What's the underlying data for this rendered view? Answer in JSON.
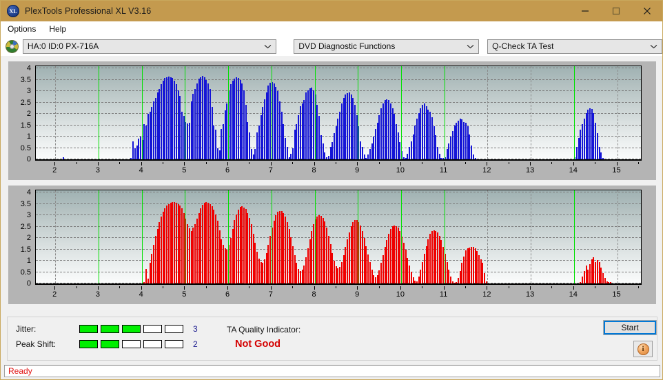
{
  "window": {
    "title": "PlexTools Professional XL V3.16",
    "app_icon": "xl-logo-icon",
    "minimize": "minimize-icon",
    "maximize": "maximize-icon",
    "close": "close-icon"
  },
  "menu": {
    "items": [
      {
        "label": "Options"
      },
      {
        "label": "Help"
      }
    ]
  },
  "toolbar": {
    "drive_icon": "optical-disc-icon",
    "drive": "HA:0 ID:0  PX-716A",
    "function": "DVD Diagnostic Functions",
    "test": "Q-Check TA Test"
  },
  "status_panel": {
    "jitter_label": "Jitter:",
    "jitter_value": "3",
    "jitter_filled": 3,
    "jitter_total": 5,
    "peak_shift_label": "Peak Shift:",
    "peak_shift_value": "2",
    "peak_shift_filled": 2,
    "peak_shift_total": 5,
    "ta_label": "TA Quality Indicator:",
    "ta_value": "Not Good",
    "ta_color": "#d40000",
    "meter_on_color": "#00ef00",
    "start_label": "Start",
    "info_label": "i"
  },
  "statusbar": {
    "text": "Ready",
    "color": "#e01010"
  },
  "chart_data": [
    {
      "type": "bar",
      "title": "Jitter (top chart)",
      "xlabel": "",
      "ylabel": "",
      "series_color": "#1515d6",
      "marker_color": "#00e000",
      "grid": true,
      "xlim": [
        1.55,
        15.55
      ],
      "ylim": [
        0,
        4.1
      ],
      "xticks": [
        2,
        3,
        4,
        5,
        6,
        7,
        8,
        9,
        10,
        11,
        12,
        13,
        14,
        15
      ],
      "yticks": [
        0,
        0.5,
        1,
        1.5,
        2,
        2.5,
        3,
        3.5,
        4
      ],
      "markers_x": [
        3,
        4,
        5,
        6,
        7,
        8,
        9,
        10,
        11,
        14
      ],
      "bar_step": 0.0435,
      "x_start": 2.0,
      "values": [
        0.0,
        0.0,
        0.0,
        0.0,
        0.08,
        0.0,
        0.0,
        0.0,
        0.0,
        0.0,
        0.0,
        0.0,
        0.0,
        0.0,
        0.0,
        0.0,
        0.0,
        0.0,
        0.0,
        0.0,
        0.0,
        0.0,
        0.0,
        0.0,
        0.0,
        0.0,
        0.0,
        0.0,
        0.0,
        0.0,
        0.0,
        0.0,
        0.0,
        0.0,
        0.0,
        0.0,
        0.0,
        0.0,
        0.0,
        0.0,
        0.05,
        0.8,
        0.5,
        0.6,
        0.92,
        1.0,
        0.85,
        1.55,
        1.5,
        2.0,
        2.1,
        2.3,
        2.55,
        2.7,
        2.95,
        3.1,
        3.3,
        3.45,
        3.58,
        3.62,
        3.65,
        3.6,
        3.58,
        3.45,
        3.3,
        3.05,
        2.8,
        2.1,
        1.9,
        1.65,
        1.58,
        1.6,
        2.55,
        2.9,
        3.1,
        3.35,
        3.55,
        3.62,
        3.68,
        3.6,
        3.5,
        3.35,
        3.1,
        2.3,
        1.5,
        1.3,
        0.5,
        0.4,
        1.35,
        1.55,
        2.15,
        2.45,
        3.0,
        3.3,
        3.45,
        3.55,
        3.6,
        3.58,
        3.5,
        3.35,
        3.05,
        2.4,
        1.65,
        1.2,
        0.45,
        0.2,
        0.45,
        1.2,
        1.5,
        1.95,
        2.3,
        2.65,
        2.95,
        3.25,
        3.38,
        3.4,
        3.35,
        3.2,
        3.0,
        2.55,
        2.1,
        1.55,
        0.95,
        0.55,
        0.1,
        0.25,
        0.5,
        1.3,
        1.55,
        1.95,
        2.35,
        2.45,
        2.6,
        2.95,
        3.05,
        3.12,
        3.15,
        3.05,
        2.85,
        2.4,
        1.9,
        1.05,
        0.7,
        0.3,
        0.08,
        0.15,
        0.55,
        0.75,
        1.15,
        1.45,
        1.8,
        2.1,
        2.45,
        2.7,
        2.85,
        2.93,
        2.95,
        2.85,
        2.7,
        2.4,
        1.95,
        1.45,
        0.8,
        0.55,
        0.2,
        0.05,
        0.2,
        0.45,
        0.7,
        1.0,
        1.35,
        1.6,
        1.95,
        2.25,
        2.45,
        2.6,
        2.65,
        2.6,
        2.45,
        2.25,
        2.0,
        1.55,
        1.2,
        0.75,
        0.35,
        0.1,
        0.05,
        0.25,
        0.55,
        0.8,
        1.1,
        1.5,
        1.8,
        2.05,
        2.25,
        2.4,
        2.45,
        2.35,
        2.2,
        2.1,
        1.85,
        1.45,
        1.05,
        0.55,
        0.25,
        0.05,
        0.05,
        0.1,
        0.45,
        0.7,
        1.0,
        1.25,
        1.5,
        1.62,
        1.7,
        1.78,
        1.75,
        1.65,
        1.62,
        1.45,
        1.1,
        0.6,
        0.2,
        0.05,
        0.0,
        0.0,
        0.0,
        0.0,
        0.0,
        0.0,
        0.0,
        0.0,
        0.0,
        0.0,
        0.0,
        0.0,
        0.0,
        0.0,
        0.0,
        0.0,
        0.0,
        0.0,
        0.0,
        0.0,
        0.0,
        0.0,
        0.0,
        0.0,
        0.0,
        0.0,
        0.0,
        0.0,
        0.0,
        0.0,
        0.0,
        0.0,
        0.0,
        0.0,
        0.0,
        0.0,
        0.0,
        0.0,
        0.0,
        0.0,
        0.0,
        0.0,
        0.0,
        0.0,
        0.0,
        0.0,
        0.0,
        0.0,
        0.0,
        0.0,
        0.0,
        0.0,
        0.1,
        0.55,
        0.95,
        1.3,
        1.55,
        1.8,
        2.05,
        2.2,
        2.25,
        2.22,
        2.05,
        1.6,
        1.15,
        0.55,
        0.3,
        0.05,
        0.0,
        0.0,
        0.0,
        0.0,
        0.0,
        0.0,
        0.0,
        0.0,
        0.0,
        0.0,
        0.0,
        0.0,
        0.0,
        0.0,
        0.0,
        0.0,
        0.0,
        0.0,
        0.0,
        0.0,
        0.0,
        0.0,
        0.0,
        0.0,
        0.0,
        0.0,
        0.0,
        0.0
      ]
    },
    {
      "type": "bar",
      "title": "Peak Shift (bottom chart)",
      "xlabel": "",
      "ylabel": "",
      "series_color": "#ef0000",
      "marker_color": "#00e000",
      "grid": true,
      "xlim": [
        1.55,
        15.55
      ],
      "ylim": [
        0,
        4.1
      ],
      "xticks": [
        2,
        3,
        4,
        5,
        6,
        7,
        8,
        9,
        10,
        11,
        12,
        13,
        14,
        15
      ],
      "yticks": [
        0,
        0.5,
        1,
        1.5,
        2,
        2.5,
        3,
        3.5,
        4
      ],
      "markers_x": [
        3,
        4,
        5,
        6,
        7,
        8,
        9,
        10,
        11,
        14
      ],
      "bar_step": 0.0435,
      "x_start": 2.0,
      "values": [
        0.0,
        0.0,
        0.0,
        0.0,
        0.0,
        0.0,
        0.0,
        0.0,
        0.0,
        0.0,
        0.0,
        0.0,
        0.0,
        0.0,
        0.0,
        0.0,
        0.0,
        0.0,
        0.0,
        0.0,
        0.0,
        0.0,
        0.0,
        0.0,
        0.0,
        0.0,
        0.0,
        0.0,
        0.0,
        0.0,
        0.0,
        0.0,
        0.0,
        0.0,
        0.0,
        0.0,
        0.0,
        0.0,
        0.0,
        0.0,
        0.0,
        0.0,
        0.0,
        0.0,
        0.0,
        0.0,
        0.0,
        0.05,
        0.65,
        0.2,
        0.9,
        1.3,
        1.7,
        2.1,
        2.4,
        2.7,
        2.95,
        3.15,
        3.3,
        3.42,
        3.5,
        3.55,
        3.58,
        3.57,
        3.55,
        3.5,
        3.42,
        3.3,
        3.1,
        2.85,
        2.6,
        2.42,
        2.3,
        2.45,
        2.6,
        2.85,
        3.1,
        3.3,
        3.45,
        3.55,
        3.58,
        3.55,
        3.5,
        3.4,
        3.25,
        3.05,
        2.75,
        2.35,
        1.95,
        1.7,
        1.55,
        1.5,
        1.7,
        2.0,
        2.4,
        2.8,
        3.05,
        3.25,
        3.38,
        3.4,
        3.35,
        3.28,
        3.1,
        2.9,
        2.6,
        2.2,
        1.8,
        1.4,
        1.1,
        0.95,
        0.9,
        1.05,
        1.35,
        1.7,
        2.1,
        2.45,
        2.75,
        3.0,
        3.15,
        3.2,
        3.18,
        3.1,
        2.95,
        2.7,
        2.4,
        2.05,
        1.65,
        1.25,
        0.9,
        0.65,
        0.55,
        0.6,
        0.8,
        1.15,
        1.55,
        1.95,
        2.3,
        2.6,
        2.82,
        2.95,
        3.0,
        2.98,
        2.9,
        2.72,
        2.45,
        2.1,
        1.72,
        1.35,
        1.0,
        0.75,
        0.68,
        0.72,
        0.95,
        1.25,
        1.6,
        1.95,
        2.25,
        2.52,
        2.7,
        2.8,
        2.78,
        2.7,
        2.55,
        2.32,
        2.0,
        1.65,
        1.28,
        0.95,
        0.6,
        0.35,
        0.28,
        0.35,
        0.58,
        0.9,
        1.25,
        1.6,
        1.9,
        2.2,
        2.4,
        2.52,
        2.55,
        2.52,
        2.45,
        2.3,
        2.08,
        1.8,
        1.48,
        1.12,
        0.8,
        0.52,
        0.28,
        0.12,
        0.1,
        0.3,
        0.62,
        0.95,
        1.3,
        1.65,
        1.95,
        2.18,
        2.3,
        2.35,
        2.32,
        2.25,
        2.1,
        1.9,
        1.62,
        1.3,
        0.95,
        0.6,
        0.3,
        0.1,
        0.02,
        0.05,
        0.25,
        0.55,
        0.9,
        1.2,
        1.45,
        1.55,
        1.58,
        1.6,
        1.62,
        1.55,
        1.42,
        1.25,
        1.05,
        0.9,
        0.45,
        0.1,
        0.0,
        0.0,
        0.0,
        0.0,
        0.0,
        0.0,
        0.0,
        0.0,
        0.0,
        0.0,
        0.0,
        0.0,
        0.0,
        0.0,
        0.0,
        0.0,
        0.0,
        0.0,
        0.0,
        0.0,
        0.0,
        0.0,
        0.0,
        0.0,
        0.0,
        0.0,
        0.0,
        0.0,
        0.0,
        0.0,
        0.0,
        0.0,
        0.0,
        0.0,
        0.0,
        0.0,
        0.0,
        0.0,
        0.0,
        0.0,
        0.0,
        0.0,
        0.0,
        0.0,
        0.0,
        0.0,
        0.0,
        0.0,
        0.0,
        0.05,
        0.3,
        0.55,
        0.8,
        0.6,
        0.85,
        1.05,
        1.15,
        0.95,
        1.02,
        0.95,
        0.7,
        0.45,
        0.25,
        0.1,
        0.05,
        0.05,
        0.0,
        0.0,
        0.0,
        0.0,
        0.0,
        0.0,
        0.0,
        0.0,
        0.0,
        0.0,
        0.0,
        0.0,
        0.0,
        0.0,
        0.0,
        0.0,
        0.0,
        0.0,
        0.0,
        0.0,
        0.0,
        0.0,
        0.0,
        0.0
      ]
    }
  ]
}
